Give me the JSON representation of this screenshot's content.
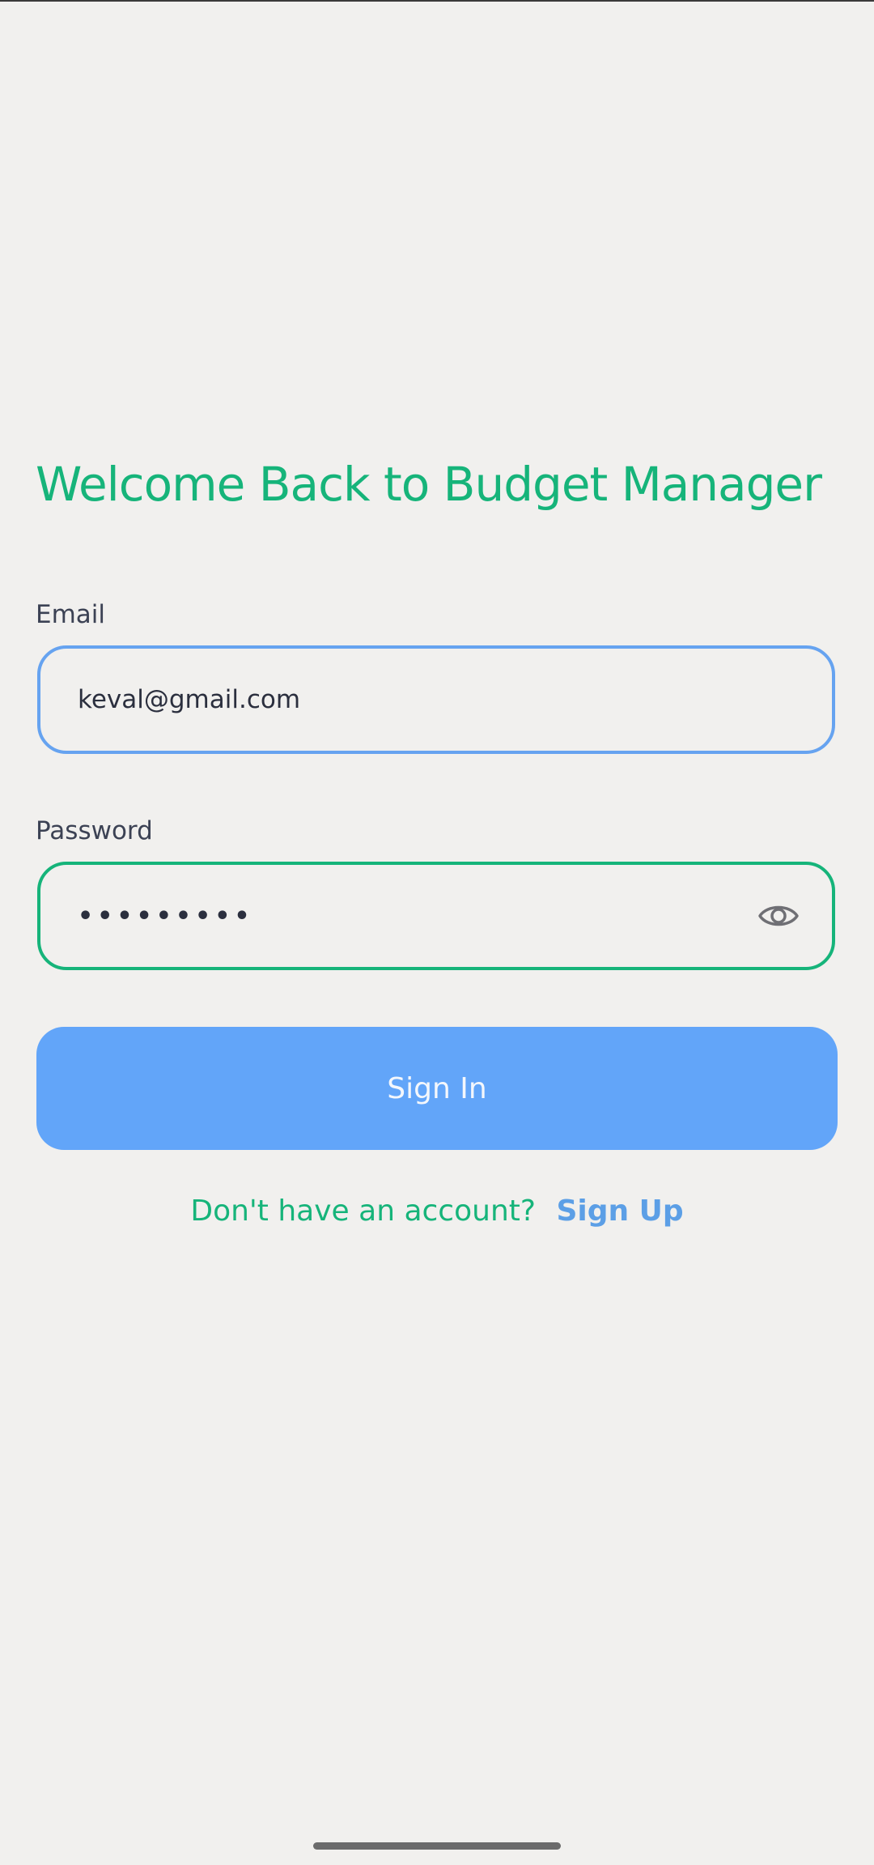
{
  "screen": {
    "title": "Welcome Back to Budget Manager"
  },
  "form": {
    "email": {
      "label": "Email",
      "value": "keval@gmail.com"
    },
    "password": {
      "label": "Password",
      "masked_value": "•••••••••",
      "toggle_icon": "eye-icon"
    },
    "submit_label": "Sign In"
  },
  "footer": {
    "prompt": "Don't have an account?",
    "link_label": "Sign Up"
  },
  "colors": {
    "primary_green": "#16b47a",
    "accent_blue": "#62a5f9",
    "link_blue": "#5c9fe6",
    "background": "#f1f0ee"
  }
}
